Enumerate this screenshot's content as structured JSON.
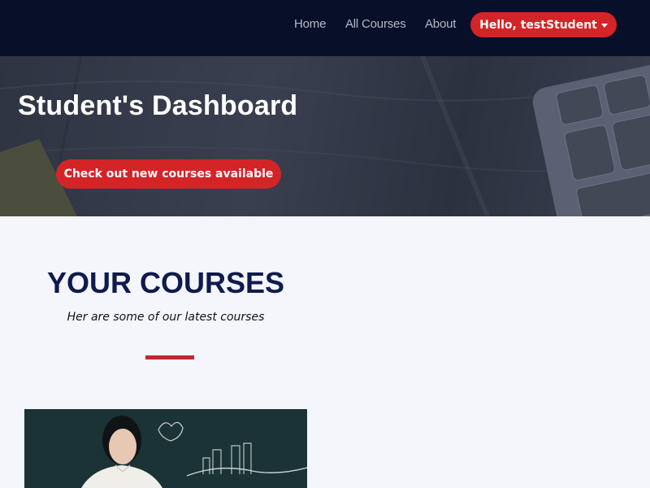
{
  "nav": {
    "links": [
      "Home",
      "All Courses",
      "About"
    ],
    "user_menu_label": "Hello, testStudent"
  },
  "hero": {
    "title": "Student's Dashboard",
    "cta_label": "Check out new courses available"
  },
  "courses": {
    "title": "YOUR COURSES",
    "subtitle": "Her are some of our latest courses"
  },
  "colors": {
    "navbar_bg": "#070f29",
    "accent_red": "#d32428",
    "heading_navy": "#0f1b4d",
    "page_bg": "#f4f6fc"
  }
}
